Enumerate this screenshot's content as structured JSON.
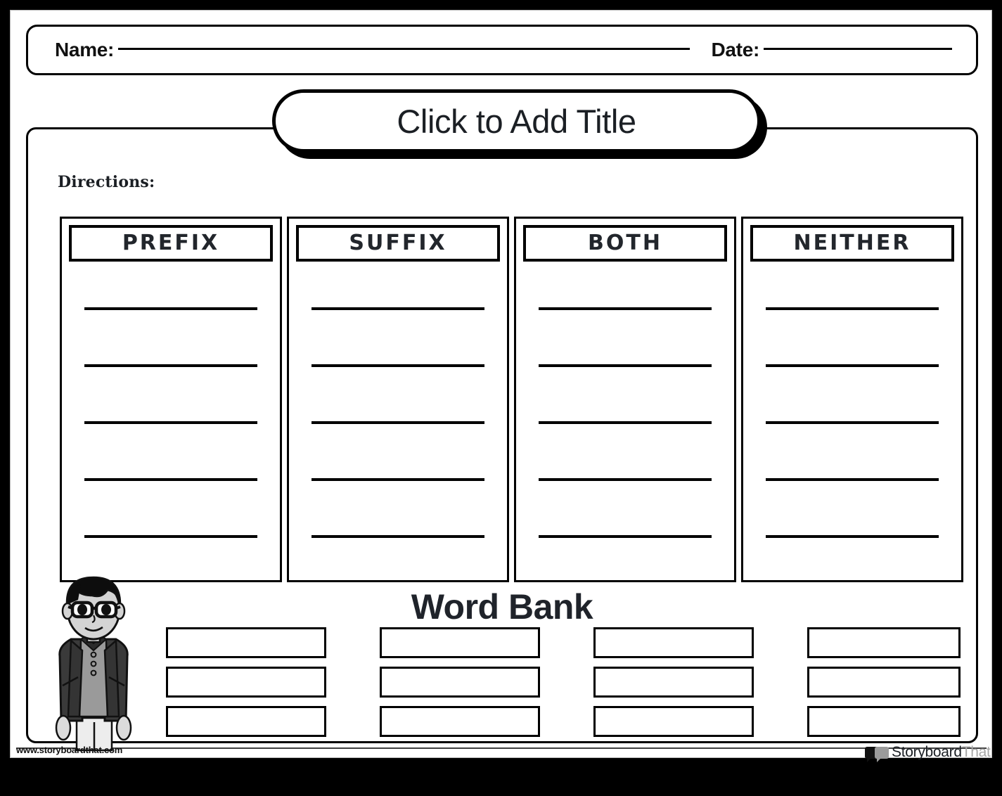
{
  "page": {
    "frame_color": "#000000",
    "sheet_color": "#ffffff",
    "ink_color": "#1b1f24"
  },
  "header": {
    "name_label": "Name:",
    "date_label": "Date:"
  },
  "title": {
    "text": "Click to Add Title"
  },
  "directions": {
    "label": "Directions:"
  },
  "columns": [
    {
      "header": "PREFIX",
      "line_count": 5
    },
    {
      "header": "SUFFIX",
      "line_count": 5
    },
    {
      "header": "BOTH",
      "line_count": 5
    },
    {
      "header": "NEITHER",
      "line_count": 5
    }
  ],
  "word_bank": {
    "title": "Word Bank",
    "columns": [
      {
        "boxes": [
          "",
          "",
          ""
        ]
      },
      {
        "boxes": [
          "",
          "",
          ""
        ]
      },
      {
        "boxes": [
          "",
          "",
          ""
        ]
      },
      {
        "boxes": [
          "",
          "",
          ""
        ]
      }
    ]
  },
  "character": {
    "name": "student-character",
    "hair_color": "#0d0d0d",
    "skin_color": "#d4d4d4",
    "jacket_color": "#3a3a3a",
    "shirt_color": "#9a9a9a",
    "pants_color": "#ededed"
  },
  "footer": {
    "watermark": "www.storyboardthat.com",
    "brand_primary": "Storyboard",
    "brand_secondary": "That"
  }
}
